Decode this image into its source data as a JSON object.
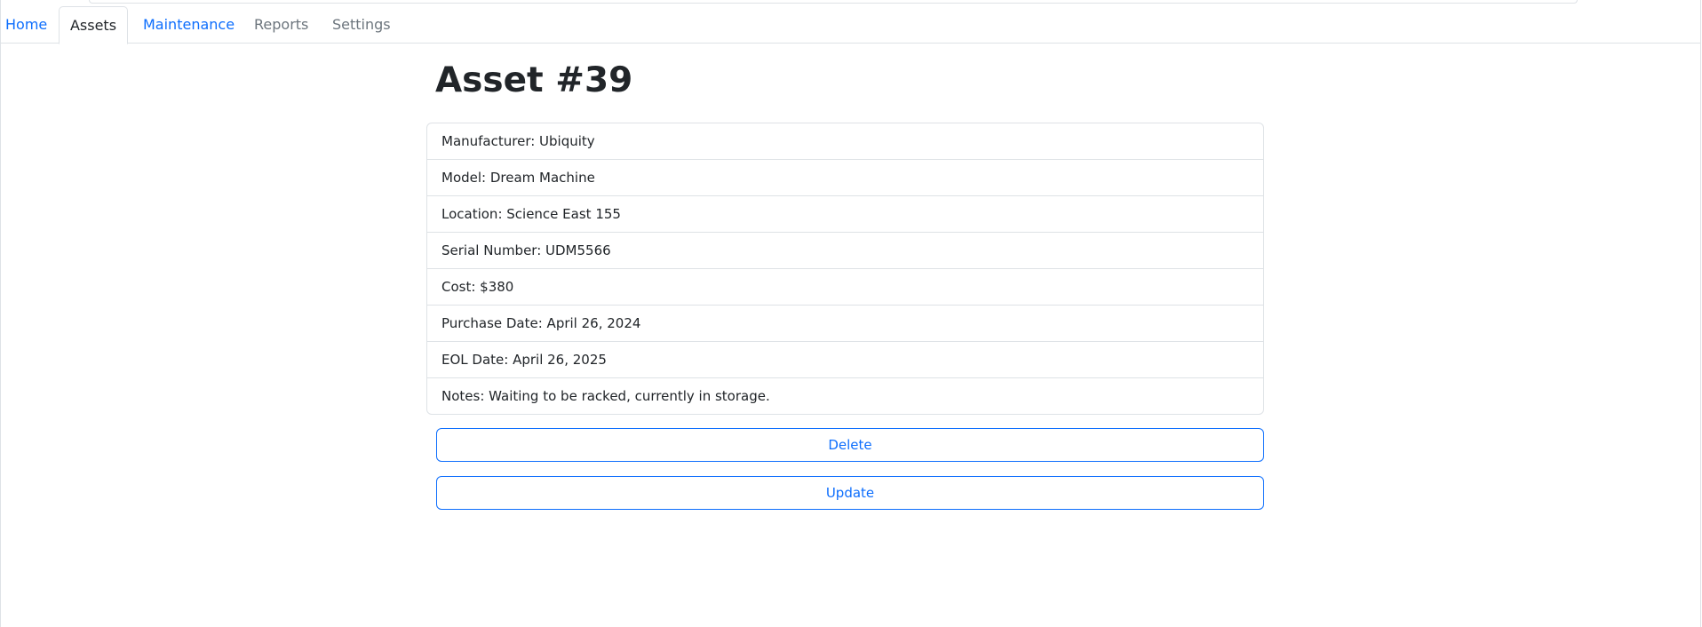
{
  "nav": {
    "tabs": [
      {
        "label": "Home",
        "state": "link"
      },
      {
        "label": "Assets",
        "state": "active"
      },
      {
        "label": "Maintenance",
        "state": "link"
      },
      {
        "label": "Reports",
        "state": "muted"
      },
      {
        "label": "Settings",
        "state": "muted"
      }
    ]
  },
  "asset": {
    "title": "Asset #39",
    "fields": [
      "Manufacturer: Ubiquity",
      "Model: Dream Machine",
      "Location: Science East 155",
      "Serial Number: UDM5566",
      "Cost: $380",
      "Purchase Date: April 26, 2024",
      "EOL Date: April 26, 2025",
      "Notes: Waiting to be racked, currently in storage."
    ]
  },
  "actions": {
    "delete_label": "Delete",
    "update_label": "Update"
  },
  "colors": {
    "link": "#0d6efd",
    "muted": "#6c757d",
    "border": "#dee2e6",
    "text": "#212529"
  }
}
